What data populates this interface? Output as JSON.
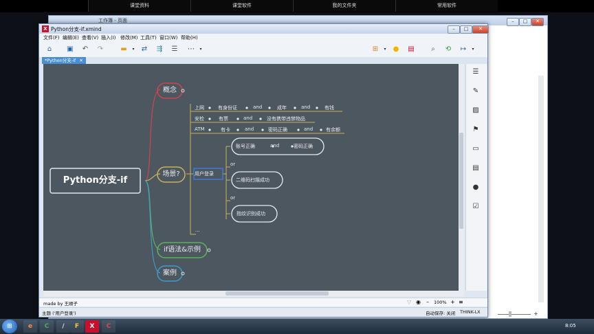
{
  "topnav": {
    "items": [
      "课堂资料",
      "课堂软件",
      "我的文件夹",
      "常用软件"
    ]
  },
  "bg_window": {
    "title": "工作簿 - 页面"
  },
  "window": {
    "title": "Python分支-if.xmind",
    "logo": "X",
    "controls": {
      "minimize": "–",
      "maximize": "□",
      "close": "✕"
    }
  },
  "menu": [
    "文件(F)",
    "编辑(E)",
    "查看(V)",
    "插入(I)",
    "修改(M)",
    "工具(T)",
    "窗口(W)",
    "帮助(H)"
  ],
  "toolbar": {
    "icons": [
      "home-icon",
      "save-icon",
      "undo-icon",
      "redo-icon",
      "folder-icon",
      "sync-icon",
      "export-icon",
      "list-icon",
      "more-icon",
      "theme-icon",
      "bulb-icon",
      "layout-icon",
      "search-icon",
      "share-icon",
      "output-icon"
    ]
  },
  "tab": {
    "label": "*Python分支-if",
    "close": "✕"
  },
  "mindmap": {
    "central": "Python分支-if",
    "branches": [
      {
        "label": "概念",
        "color": "#d2444c"
      },
      {
        "label": "场景?",
        "color": "#c9b25a"
      },
      {
        "label": "if语法&示例",
        "color": "#5db35a"
      },
      {
        "label": "案例",
        "color": "#3c9dc9"
      }
    ],
    "scenes": [
      [
        "上网",
        "有身份证",
        "and",
        "成年",
        "and",
        "有钱"
      ],
      [
        "安检",
        "有票",
        "and",
        "没有携带违禁物品"
      ],
      [
        "ATM",
        "有卡",
        "and",
        "密码正确",
        "and",
        "有余额"
      ]
    ],
    "login": {
      "label": "用户登录",
      "cloud1": [
        "账号正确",
        "and",
        "密码正确"
      ],
      "or1": "or",
      "cloud2": "二维码扫描成功",
      "or2": "or",
      "cloud3": "指纹识别成功",
      "more": "..."
    }
  },
  "notes": {
    "text": "made by 王顺子"
  },
  "zoom": {
    "value": "100%",
    "minus": "–",
    "plus": "+"
  },
  "status": {
    "left": "主题 ('用户登录')",
    "autosave": "自动保存: 关闭",
    "user": "THINK-LX"
  },
  "taskbar": {
    "apps": [
      "e",
      "C",
      "/",
      "F",
      "X",
      "C"
    ],
    "clock": "8:05"
  }
}
